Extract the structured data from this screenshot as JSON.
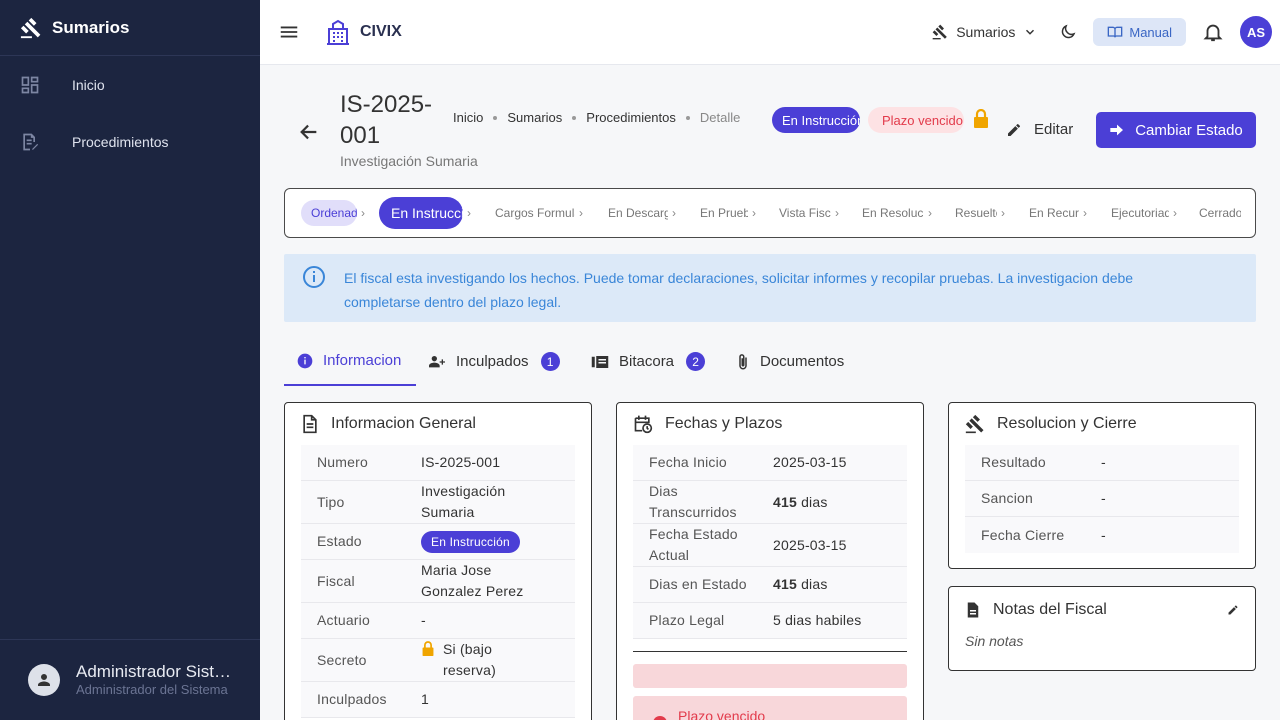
{
  "sidebar": {
    "title": "Sumarios",
    "items": [
      {
        "label": "Inicio",
        "icon": "dashboard-icon"
      },
      {
        "label": "Procedimientos",
        "icon": "edit-document-icon"
      }
    ],
    "user": {
      "name": "Administrador Sistema",
      "role": "Administrador del Sistema"
    }
  },
  "topbar": {
    "brand": "CIVIX",
    "module_select": "Sumarios",
    "manual_label": "Manual",
    "avatar_initials": "AS"
  },
  "header": {
    "number": "IS-2025-001",
    "subtitle": "Investigación Sumaria",
    "breadcrumb": [
      "Inicio",
      "Sumarios",
      "Procedimientos",
      "Detalle"
    ],
    "status_badge": "En Instrucción",
    "deadline_badge": "Plazo vencido",
    "edit_label": "Editar",
    "change_state_label": "Cambiar Estado"
  },
  "stepper": [
    "Ordenado",
    "En Instrucción",
    "Cargos Formulados",
    "En Descargos",
    "En Prueba",
    "Vista Fiscal",
    "En Resolución",
    "Resuelto",
    "En Recurso",
    "Ejecutoriado",
    "Cerrado"
  ],
  "info_text": "El fiscal esta investigando los hechos. Puede tomar declaraciones, solicitar informes y recopilar pruebas. La investigacion debe completarse dentro del plazo legal.",
  "tabs": [
    {
      "label": "Informacion",
      "count": null
    },
    {
      "label": "Inculpados",
      "count": "1"
    },
    {
      "label": "Bitacora",
      "count": "2"
    },
    {
      "label": "Documentos",
      "count": null
    }
  ],
  "general": {
    "title": "Informacion General",
    "rows": {
      "numero": {
        "k": "Numero",
        "v": "IS-2025-001"
      },
      "tipo": {
        "k": "Tipo",
        "v": "Investigación Sumaria"
      },
      "estado": {
        "k": "Estado",
        "v": "En Instrucción"
      },
      "fiscal": {
        "k": "Fiscal",
        "v": "Maria Jose Gonzalez Perez"
      },
      "actuario": {
        "k": "Actuario",
        "v": "-"
      },
      "secreto": {
        "k": "Secreto",
        "v": "Si (bajo reserva)"
      },
      "inculpados": {
        "k": "Inculpados",
        "v": "1"
      }
    }
  },
  "fechas": {
    "title": "Fechas y Plazos",
    "rows": {
      "inicio": {
        "k": "Fecha Inicio",
        "v": "2025-03-15"
      },
      "transcurridos": {
        "k": "Dias Transcurridos",
        "num": "415",
        "unit": "dias"
      },
      "estado_actual": {
        "k": "Fecha Estado Actual",
        "v": "2025-03-15"
      },
      "en_estado": {
        "k": "Dias en Estado",
        "num": "415",
        "unit": "dias"
      },
      "plazo": {
        "k": "Plazo Legal",
        "v": "5 dias habiles"
      }
    },
    "alert": "Plazo vencido"
  },
  "resolucion": {
    "title": "Resolucion y Cierre",
    "rows": {
      "resultado": {
        "k": "Resultado",
        "v": "-"
      },
      "sancion": {
        "k": "Sancion",
        "v": "-"
      },
      "cierre": {
        "k": "Fecha Cierre",
        "v": "-"
      }
    }
  },
  "notas": {
    "title": "Notas del Fiscal",
    "empty": "Sin notas"
  },
  "colors": {
    "primary": "#4b3fd6",
    "sidebar": "#1c2540",
    "danger": "#e23b4b",
    "info_bg": "#dce9f8"
  }
}
